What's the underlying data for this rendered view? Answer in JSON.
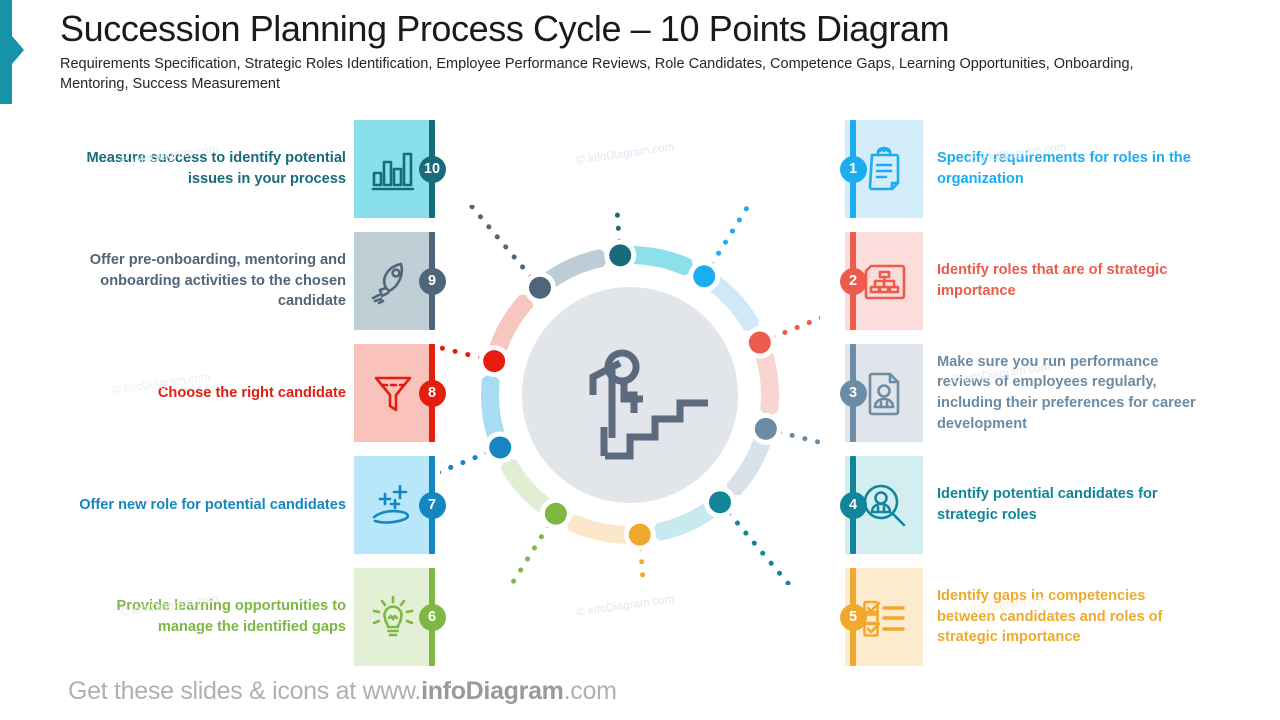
{
  "header": {
    "title": "Succession Planning Process Cycle – 10 Points Diagram",
    "subtitle": "Requirements Specification, Strategic Roles Identification, Employee Performance Reviews, Role Candidates, Competence Gaps, Learning Opportunities, Onboarding, Mentoring, Success Measurement"
  },
  "accent_color": "#1793a8",
  "footer": {
    "prefix": "Get these slides & icons at www.",
    "brand": "infoDiagram",
    "suffix": ".com"
  },
  "watermark": "© infoDiagram.com",
  "steps": [
    {
      "number": "1",
      "side": "right",
      "label": "Specify requirements  for roles in the organization",
      "icon": "clipboard-icon",
      "color": "#1cacf0",
      "tile_bg": "#d4edfb",
      "arc_color": "#cfe9f9",
      "dot_color": "#1cacf0"
    },
    {
      "number": "2",
      "side": "right",
      "label": "Identify roles that are of strategic importance",
      "icon": "org-chart-icon",
      "color": "#ec5b4b",
      "tile_bg": "#fbdedb",
      "arc_color": "#f8d5d0",
      "dot_color": "#ec5b4b"
    },
    {
      "number": "3",
      "side": "right",
      "label": "Make sure you run performance reviews of employees regularly, including their preferences for career development",
      "icon": "employee-document-icon",
      "color": "#6c8ba4",
      "tile_bg": "#dfe5ea",
      "arc_color": "#d9e2e8",
      "dot_color": "#6c8ba4"
    },
    {
      "number": "4",
      "side": "right",
      "label": "Identify potential candidates for strategic roles",
      "icon": "candidate-search-icon",
      "color": "#12859a",
      "tile_bg": "#d2eef1",
      "arc_color": "#c9e9f0",
      "dot_color": "#12859a"
    },
    {
      "number": "5",
      "side": "right",
      "label": "Identify gaps in competencies between candidates and roles of strategic importance",
      "icon": "checklist-icon",
      "color": "#f0a92c",
      "tile_bg": "#fcebcd",
      "arc_color": "#fbe7c9",
      "dot_color": "#f0a92c"
    },
    {
      "number": "6",
      "side": "left",
      "label": "Provide learning opportunities  to manage the identified gaps",
      "icon": "lightbulb-icon",
      "color": "#7cb843",
      "tile_bg": "#e4f0d5",
      "arc_color": "#e0efd3",
      "dot_color": "#7cb843"
    },
    {
      "number": "7",
      "side": "left",
      "label": "Offer new role for potential candidates",
      "icon": "hand-plus-icon",
      "color": "#1487c2",
      "tile_bg": "#b8e6fa",
      "arc_color": "#a8dcf5",
      "dot_color": "#1487c2"
    },
    {
      "number": "8",
      "side": "left",
      "label": "Choose the right candidate",
      "icon": "funnel-icon",
      "color": "#e41d0e",
      "tile_bg": "#f9c3bc",
      "arc_color": "#f6c6bf",
      "dot_color": "#e41d0e"
    },
    {
      "number": "9",
      "side": "left",
      "label": "Offer pre-onboarding, mentoring and onboarding activities to the chosen candidate",
      "icon": "rocket-icon",
      "color": "#4f6579",
      "tile_bg": "#c0ced6",
      "arc_color": "#bccdd6",
      "dot_color": "#4f6579"
    },
    {
      "number": "10",
      "side": "left",
      "label": "Measure success to identify potential issues in your process",
      "icon": "bar-chart-icon",
      "color": "#186b7a",
      "tile_bg": "#8ae0ea",
      "arc_color": "#8ddfe9",
      "dot_color": "#186b7a"
    }
  ],
  "center": {
    "icon": "person-climbing-stairs-icon",
    "disc_color": "#e2e5ea",
    "figure_color": "#5b6b7d"
  }
}
